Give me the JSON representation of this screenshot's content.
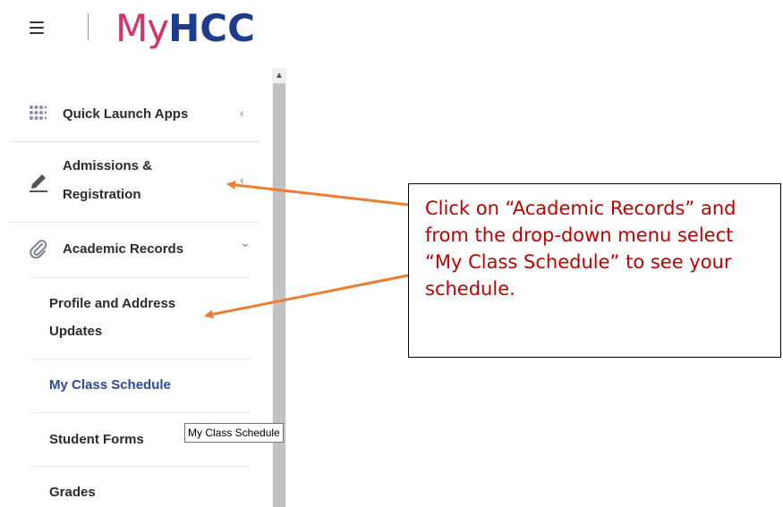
{
  "header": {
    "logo_my": "My",
    "logo_hcc": "HCC"
  },
  "nav": {
    "items": [
      {
        "label": "Quick Launch Apps",
        "icon": "grid-dots-icon",
        "chevron": "‹"
      },
      {
        "label_line1": "Admissions &",
        "label_line2": "Registration",
        "icon": "pencil-icon",
        "chevron": "‹"
      },
      {
        "label": "Academic Records",
        "icon": "paperclip-icon",
        "chevron": "⌄"
      }
    ],
    "sub_items": [
      {
        "label_line1": "Profile and Address",
        "label_line2": "Updates"
      },
      {
        "label": "My Class Schedule",
        "active": true
      },
      {
        "label": "Student Forms"
      },
      {
        "label": "Grades"
      }
    ]
  },
  "tooltip": {
    "text": "My Class Schedule"
  },
  "callout": {
    "text": "Click on “Academic Records” and from the drop-down menu select “My Class Schedule” to see your schedule."
  },
  "colors": {
    "logo_my": "#d6336c",
    "logo_hcc": "#1f3b8c",
    "active_link": "#2d4a9a",
    "callout_text": "#c00000",
    "arrow": "#ed7d31"
  }
}
